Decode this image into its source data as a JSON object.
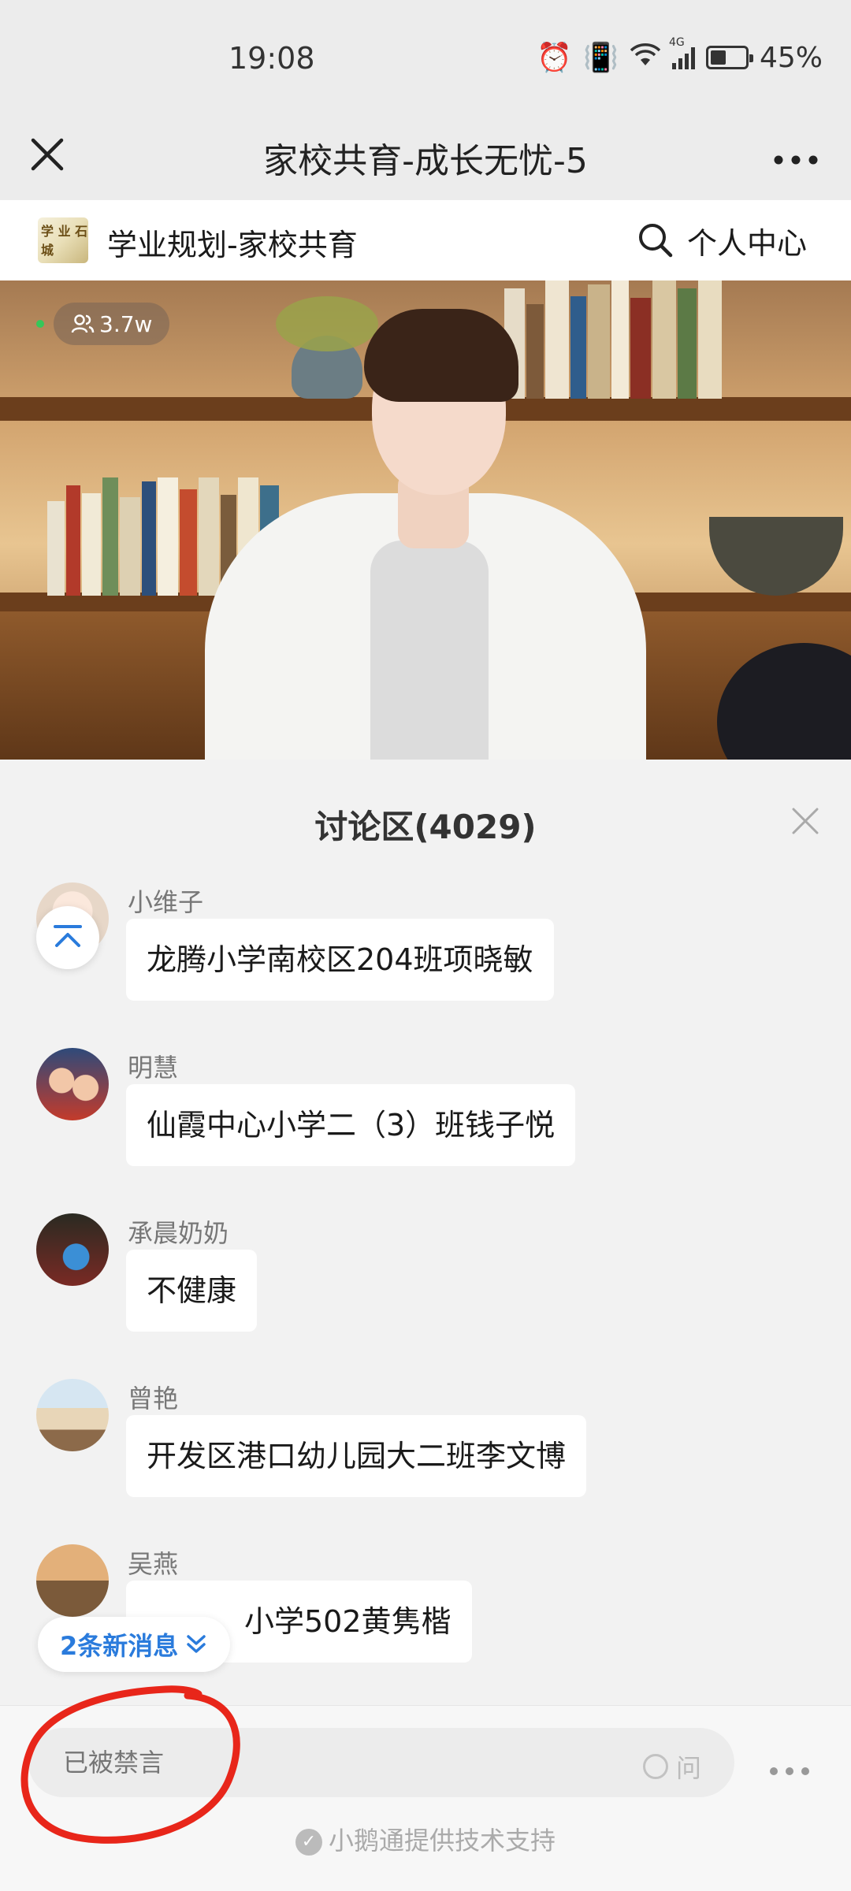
{
  "status_bar": {
    "time": "19:08",
    "battery_percent": "45%",
    "battery_level": 0.45,
    "network": "4G"
  },
  "title_bar": {
    "title": "家校共育-成长无忧-5",
    "close_icon": "close-icon",
    "more_icon": "more-icon"
  },
  "channel": {
    "name": "学业规划-家校共育",
    "personal_center": "个人中心",
    "logo_text": "学 业 石 城"
  },
  "video": {
    "viewers": "3.7w"
  },
  "discussion": {
    "title": "讨论区(4029)",
    "messages": [
      {
        "nickname": "小维子",
        "text": "龙腾小学南校区204班项晓敏"
      },
      {
        "nickname": "明慧",
        "text": "仙霞中心小学二（3）班钱子悦"
      },
      {
        "nickname": "承晨奶奶",
        "text": "不健康"
      },
      {
        "nickname": "曾艳",
        "text": "开发区港口幼儿园大二班李文博"
      },
      {
        "nickname": "吴燕",
        "text": "小学502黄隽楷"
      }
    ],
    "new_messages": "2条新消息"
  },
  "input_bar": {
    "placeholder": "已被禁言",
    "ask_label": "问",
    "powered_by": "小鹅通提供技术支持"
  },
  "colors": {
    "accent": "#2a7bdc",
    "annotation": "#e8261a",
    "live": "#35c759"
  }
}
